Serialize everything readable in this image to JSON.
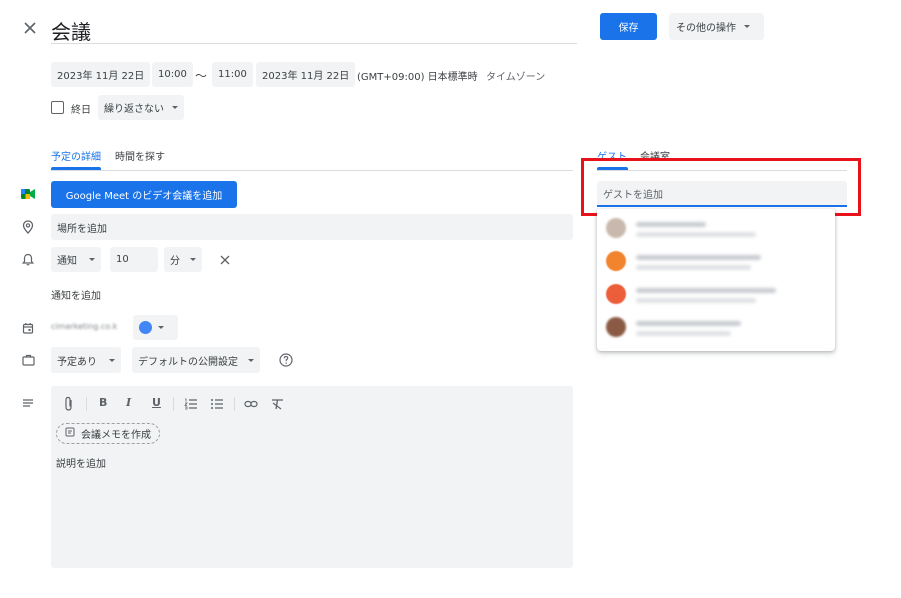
{
  "header": {
    "title": "会議",
    "save_label": "保存",
    "more_actions_label": "その他の操作"
  },
  "datetime": {
    "start_date": "2023年 11月 22日",
    "start_time": "10:00",
    "separator": "〜",
    "end_time": "11:00",
    "end_date": "2023年 11月 22日",
    "timezone_name": "(GMT+09:00) 日本標準時",
    "timezone_link": "タイムゾーン"
  },
  "options": {
    "allday_label": "終日",
    "repeat_label": "繰り返さない"
  },
  "tabs": {
    "details": "予定の詳細",
    "find_time": "時間を探す"
  },
  "meet_button": "Google Meet のビデオ会議を追加",
  "location_placeholder": "場所を追加",
  "notification": {
    "type": "通知",
    "value": "10",
    "unit": "分",
    "add_label": "通知を追加"
  },
  "calendar": {
    "name": "cimarketing.co.k",
    "color": "#4285f4"
  },
  "status": {
    "busy": "予定あり",
    "visibility": "デフォルトの公開設定"
  },
  "description": {
    "create_notes": "会議メモを作成",
    "placeholder": "説明を追加"
  },
  "toolbar_icons": [
    "attach-icon",
    "bold-icon",
    "italic-icon",
    "underline-icon",
    "numbered-list-icon",
    "bulleted-list-icon",
    "link-icon",
    "clear-format-icon"
  ],
  "guests": {
    "tab_guests": "ゲスト",
    "tab_rooms": "会議室",
    "input_placeholder": "ゲストを追加"
  },
  "colors": {
    "accent": "#1a73e8",
    "highlight": "#e8121b",
    "meet_button": "#1a73e8"
  }
}
